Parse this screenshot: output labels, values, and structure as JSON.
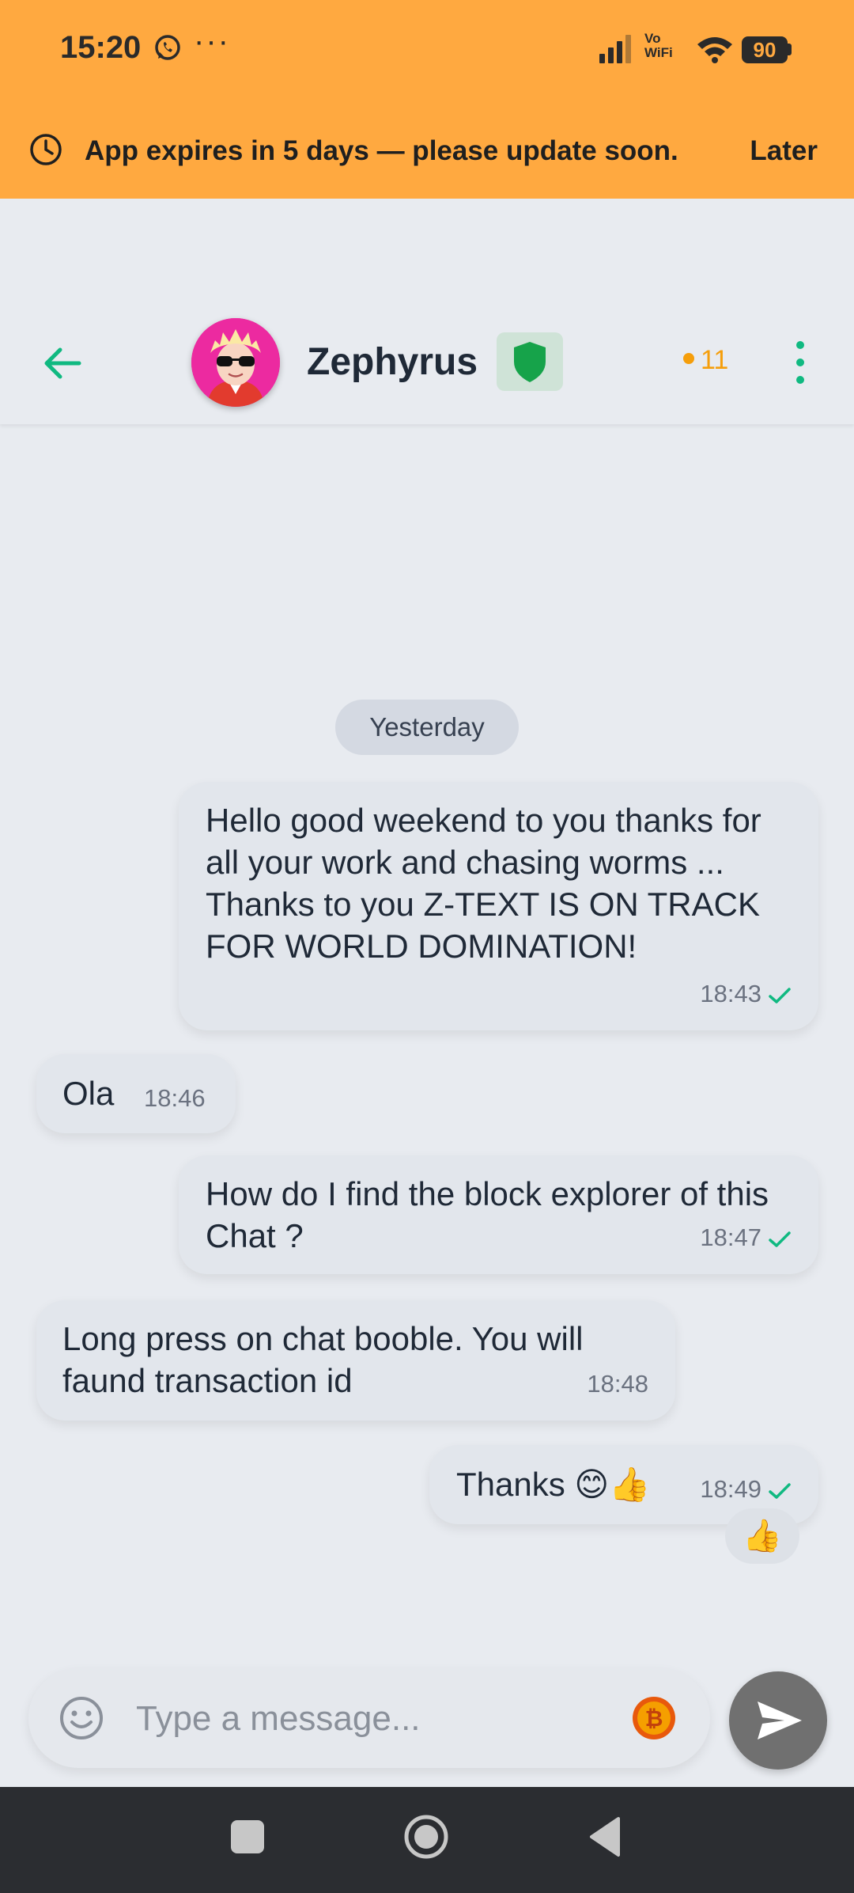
{
  "status_bar": {
    "time": "15:20",
    "overflow": "···",
    "network_label": "Vo\nWiFi",
    "battery": "90",
    "icons": [
      "whatsapp-icon",
      "signal-icon",
      "wifi-icon",
      "battery-icon"
    ]
  },
  "banner": {
    "message": "App expires in 5 days — please update soon.",
    "action_label": "Later",
    "icon": "clock-icon",
    "color": "#ffa940"
  },
  "header": {
    "contact_name": "Zephyrus",
    "online_count": "11",
    "icons": [
      "back-arrow-icon",
      "avatar",
      "shield-icon",
      "more-vert-icon"
    ],
    "accent_color": "#10b981",
    "online_color": "#f59e0b"
  },
  "chat": {
    "date_separator": "Yesterday",
    "messages": [
      {
        "direction": "outgoing",
        "text": "Hello good weekend to you thanks for all your work and chasing worms ...               Thanks to you Z-TEXT IS ON TRACK FOR WORLD DOMINATION!",
        "time": "18:43",
        "status": "sent"
      },
      {
        "direction": "incoming",
        "text": "Ola",
        "time": "18:46"
      },
      {
        "direction": "outgoing",
        "text": "How do I find the block explorer of this Chat ?",
        "time": "18:47",
        "status": "sent"
      },
      {
        "direction": "incoming",
        "text": "Long press on chat booble. You will faund transaction id",
        "time": "18:48"
      },
      {
        "direction": "outgoing",
        "text": "Thanks 😊👍",
        "time": "18:49",
        "status": "sent",
        "reaction": "👍"
      }
    ]
  },
  "composer": {
    "placeholder": "Type a message...",
    "value": "",
    "icons": [
      "emoji-icon",
      "bitcoin-coin-icon",
      "send-icon"
    ]
  },
  "nav_bar": {
    "icons": [
      "recents-icon",
      "home-icon",
      "back-icon"
    ]
  }
}
